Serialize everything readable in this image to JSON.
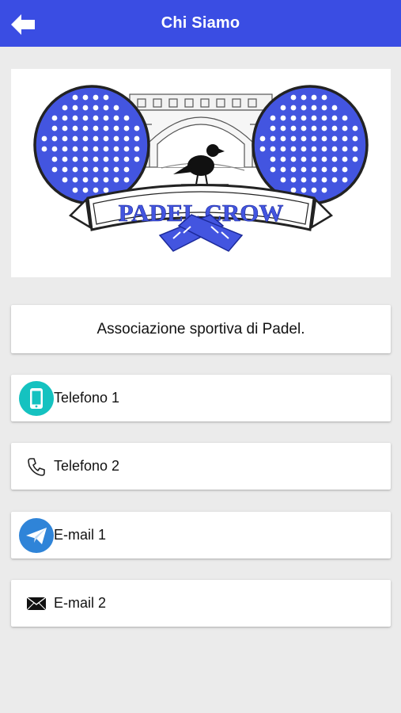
{
  "header": {
    "title": "Chi Siamo",
    "back_icon": "arrow-left-icon",
    "background_color": "#3a4de3"
  },
  "logo": {
    "text": "PADEL CROW",
    "accent_color": "#4355e0"
  },
  "description": "Associazione sportiva di Padel.",
  "contacts": [
    {
      "label": "Telefono 1",
      "icon": "mobile-phone-icon"
    },
    {
      "label": "Telefono 2",
      "icon": "phone-handset-icon"
    },
    {
      "label": "E-mail 1",
      "icon": "paper-plane-mail-icon"
    },
    {
      "label": "E-mail 2",
      "icon": "envelope-icon"
    }
  ]
}
